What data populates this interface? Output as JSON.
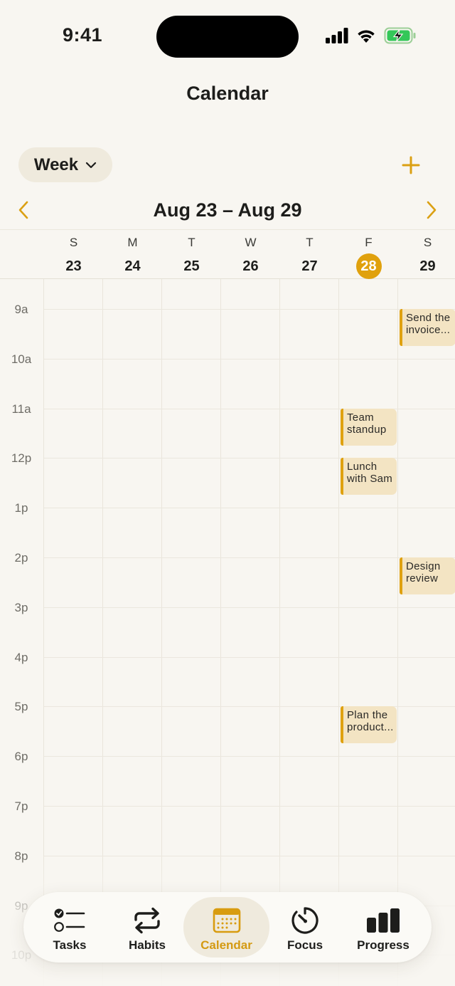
{
  "status_bar": {
    "time": "9:41"
  },
  "header": {
    "title": "Calendar"
  },
  "toolbar": {
    "view_label": "Week"
  },
  "range": {
    "label": "Aug 23 – Aug 29"
  },
  "days": [
    {
      "letter": "S",
      "num": "23",
      "today": false
    },
    {
      "letter": "M",
      "num": "24",
      "today": false
    },
    {
      "letter": "T",
      "num": "25",
      "today": false
    },
    {
      "letter": "W",
      "num": "26",
      "today": false
    },
    {
      "letter": "T",
      "num": "27",
      "today": false
    },
    {
      "letter": "F",
      "num": "28",
      "today": true
    },
    {
      "letter": "S",
      "num": "29",
      "today": false
    }
  ],
  "hours": [
    "9a",
    "10a",
    "11a",
    "12p",
    "1p",
    "2p",
    "3p",
    "4p",
    "5p",
    "6p",
    "7p",
    "8p",
    "9p",
    "10p"
  ],
  "events": [
    {
      "title": "Send the invoice...",
      "day": 6,
      "start": 9.0,
      "end": 9.75
    },
    {
      "title": "Team standup",
      "day": 5,
      "start": 11.0,
      "end": 11.75
    },
    {
      "title": "Lunch with Sam",
      "day": 5,
      "start": 12.0,
      "end": 12.75
    },
    {
      "title": "Design review",
      "day": 6,
      "start": 14.0,
      "end": 14.75
    },
    {
      "title": "Plan the product...",
      "day": 5,
      "start": 17.0,
      "end": 17.75
    }
  ],
  "colors": {
    "accent": "#e0a10d",
    "event_bg": "#f3e4c3",
    "background": "#f8f6f1"
  },
  "tabs": [
    {
      "label": "Tasks",
      "icon": "tasks-icon",
      "active": false
    },
    {
      "label": "Habits",
      "icon": "repeat-icon",
      "active": false
    },
    {
      "label": "Calendar",
      "icon": "calendar-icon",
      "active": true
    },
    {
      "label": "Focus",
      "icon": "timer-icon",
      "active": false
    },
    {
      "label": "Progress",
      "icon": "bar-chart-icon",
      "active": false
    }
  ]
}
